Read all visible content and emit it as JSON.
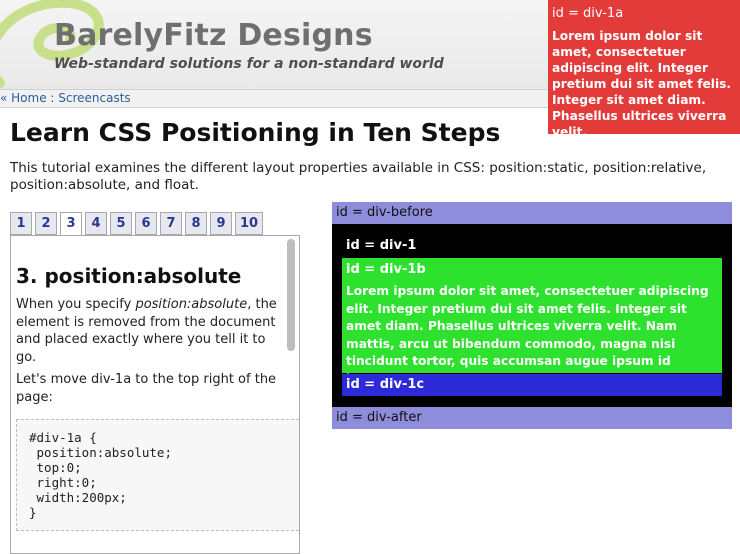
{
  "header": {
    "site_title": "BarelyFitz Designs",
    "tagline": "Web-standard solutions for a non-standard world"
  },
  "breadcrumb": {
    "prefix": "« ",
    "home": "Home",
    "separator": " : ",
    "current": "Screencasts"
  },
  "page": {
    "title": "Learn CSS Positioning in Ten Steps",
    "intro": "This tutorial examines the different layout properties available in CSS: position:static, position:relative, position:absolute, and float."
  },
  "tabs": [
    "1",
    "2",
    "3",
    "4",
    "5",
    "6",
    "7",
    "8",
    "9",
    "10"
  ],
  "active_tab": "3",
  "step": {
    "title": "3. position:absolute",
    "text_before": "When you specify ",
    "text_em": "position:absolute",
    "text_after": ", the element is removed from the document and placed exactly where you tell it to go.",
    "text2": "Let's move div-1a to the top right of the page:",
    "code": "#div-1a {\n position:absolute;\n top:0;\n right:0;\n width:200px;\n}"
  },
  "demo": {
    "div_before": "id = div-before",
    "div_1": "id = div-1",
    "div_1b_label": "id = div-1b",
    "div_1b_text": "Lorem ipsum dolor sit amet, consectetuer adipiscing elit. Integer pretium dui sit amet felis. Integer sit amet diam. Phasellus ultrices viverra velit. Nam mattis, arcu ut bibendum commodo, magna nisi tincidunt tortor, quis accumsan augue ipsum id lorem.",
    "div_1c": "id = div-1c",
    "div_after": "id = div-after",
    "div_1a_label": "id = div-1a",
    "div_1a_text": "Lorem ipsum dolor sit amet, consectetuer adipiscing elit. Integer pretium dui sit amet felis. Integer sit amet diam. Phasellus ultrices viverra velit."
  },
  "colors": {
    "div_before": "#8d8ddc",
    "div_1": "#000000",
    "div_1a": "#e33a3a",
    "div_1b": "#2ee12e",
    "div_1c": "#2d2ad8"
  }
}
